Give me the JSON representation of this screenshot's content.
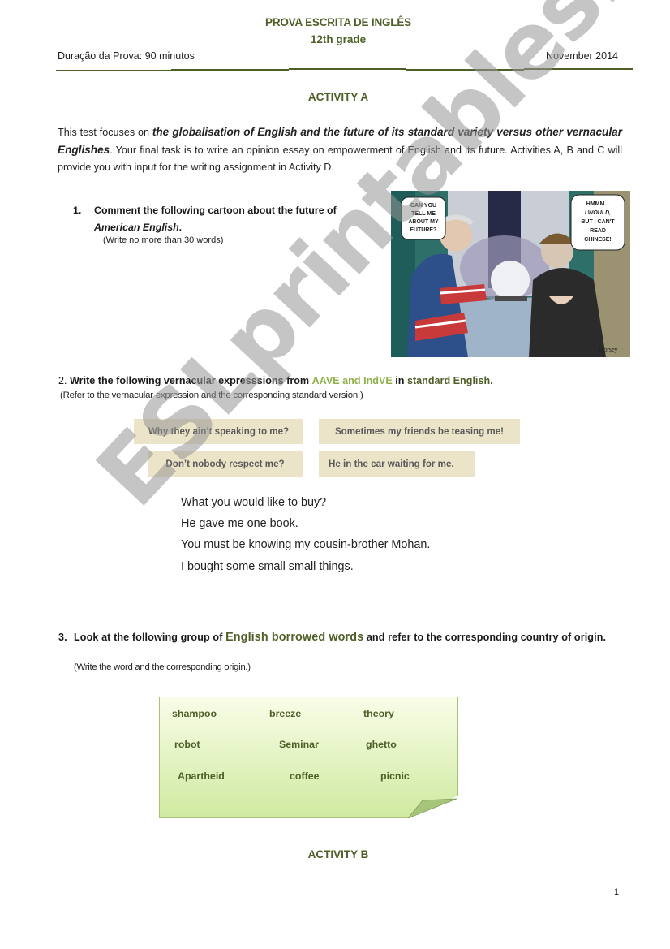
{
  "header": {
    "title": "PROVA ESCRITA DE INGLÊS",
    "grade": "12th grade",
    "duration": "Duração da Prova: 90 minutos",
    "date": "November 2014"
  },
  "activity_a": {
    "title": "ACTIVITY A",
    "intro": {
      "part1": "This test focuses on ",
      "emphasis": "the globalisation of English and the future of its standard variety versus other vernacular Englishes",
      "part2": ". Your final task is to write an opinion essay on empowerment of English and its future. Activities A, B and C will provide you with input for the writing assignment in Activity D."
    },
    "question1": {
      "number": "1.",
      "text": "Comment the following cartoon about the future of",
      "emphasis": "American English",
      "end": ".",
      "note": "(Write no more than 30 words)",
      "cartoon": {
        "bubble_left": [
          "CAN YOU",
          "TELL ME",
          "ABOUT MY",
          "FUTURE?"
        ],
        "bubble_right": [
          "HMMM...",
          "I WOULD,",
          "BUT I CAN'T",
          "READ",
          "CHINESE!"
        ],
        "signature": "Horsey"
      }
    },
    "question2": {
      "number": "2.",
      "text": "Write the following vernacular expresssions from",
      "highlight_light": "AAVE and IndVE",
      "text2": "in",
      "highlight_dark": "standard English.",
      "note": "(Refer to the vernacular expression and the corresponding standard version.)",
      "aave_boxes": [
        "Why they ain’t speaking to me?",
        "Sometimes my friends be teasing me!",
        "Don’t nobody respect me?",
        "He in the car waiting for me."
      ],
      "indve_lines": [
        "What you would like to buy?",
        "He gave me one book.",
        "You must be knowing my cousin-brother Mohan.",
        "I bought some small small things."
      ]
    },
    "question3": {
      "number": "3.",
      "text1": "Look at the following group of",
      "highlight": "English borrowed words",
      "text2": "and refer to the corresponding country of origin.",
      "note": "(Write the word and the corresponding origin.)",
      "words": [
        "shampoo",
        "breeze",
        "theory",
        "robot",
        "Seminar",
        "ghetto",
        "Apartheid",
        "coffee",
        "picnic"
      ]
    }
  },
  "activity_b": {
    "title": "ACTIVITY B"
  },
  "page_number": "1",
  "watermark": "ESLprintables.com",
  "colors": {
    "heading_green": "#4f5f28",
    "light_green": "#8fb04a",
    "beige_box": "#ece4c8",
    "note_green": "#cfeaa0"
  }
}
